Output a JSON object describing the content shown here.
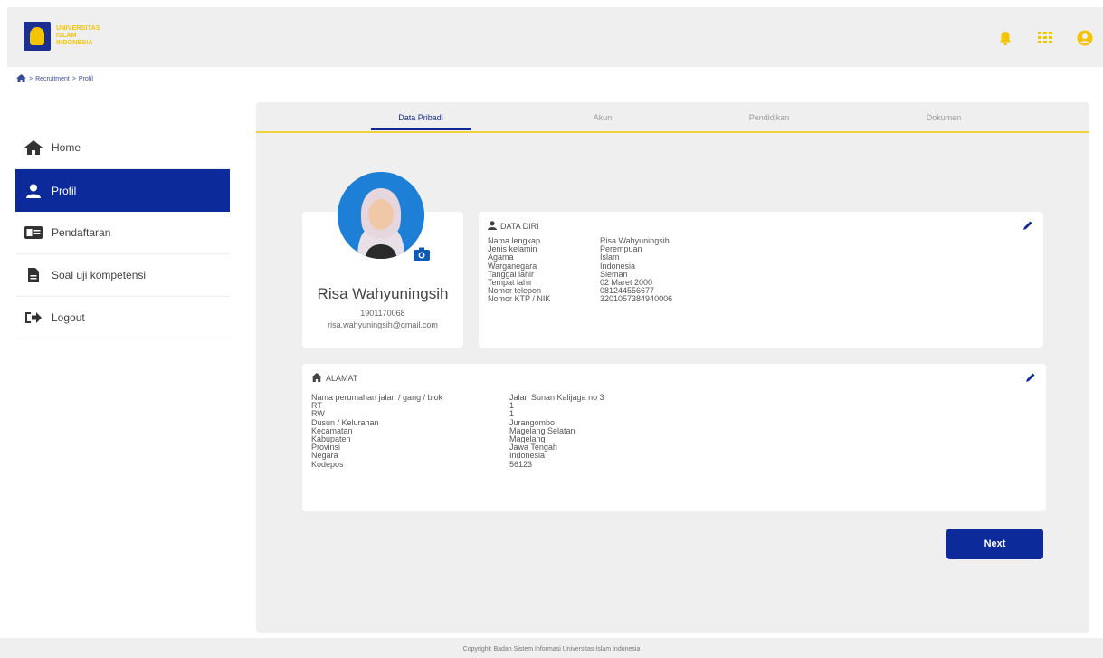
{
  "header": {
    "logo_line1": "UNIVERSITAS",
    "logo_line2": "ISLAM",
    "logo_line3": "INDONESIA",
    "icons": [
      "bell-icon",
      "apps-grid-icon",
      "user-circle-icon"
    ],
    "accent_color": "#f4c400"
  },
  "breadcrumb": {
    "items": [
      "Recruitment",
      "Profil"
    ],
    "separator": ">"
  },
  "sidebar": {
    "items": [
      {
        "label": "Home",
        "icon": "home-icon"
      },
      {
        "label": "Profil",
        "icon": "user-icon",
        "active": true
      },
      {
        "label": "Pendaftaran",
        "icon": "id-card-icon"
      },
      {
        "label": "Soal uji kompetensi",
        "icon": "file-icon"
      },
      {
        "label": "Logout",
        "icon": "logout-icon"
      }
    ]
  },
  "tabs": [
    {
      "label": "Data Pribadi",
      "active": true
    },
    {
      "label": "Akun"
    },
    {
      "label": "Pendidikan"
    },
    {
      "label": "Dokumen"
    }
  ],
  "profile": {
    "name": "Risa Wahyuningsih",
    "id": "1901170068",
    "email": "risa.wahyuningsih@gmail.com"
  },
  "data_diri": {
    "title": "DATA DIRI",
    "rows": [
      {
        "key": "Nama lengkap",
        "value": "Risa Wahyuningsih"
      },
      {
        "key": "Jenis kelamin",
        "value": "Perempuan"
      },
      {
        "key": "Agama",
        "value": "Islam"
      },
      {
        "key": "Warganegara",
        "value": "Indonesia"
      },
      {
        "key": "Tanggal lahir",
        "value": "Sleman"
      },
      {
        "key": "Tempat lahir",
        "value": "02 Maret 2000"
      },
      {
        "key": "Nomor telepon",
        "value": "081244556677"
      },
      {
        "key": "Nomor KTP / NIK",
        "value": "3201057384940006"
      }
    ]
  },
  "alamat": {
    "title": "ALAMAT",
    "rows": [
      {
        "key": "Nama perumahan jalan / gang /  blok",
        "value": "Jalan Sunan Kalijaga no 3"
      },
      {
        "key": "RT",
        "value": "1"
      },
      {
        "key": "RW",
        "value": "1"
      },
      {
        "key": "Dusun / Kelurahan",
        "value": "Jurangombo"
      },
      {
        "key": "Kecamatan",
        "value": "Magelang Selatan"
      },
      {
        "key": "Kabupaten",
        "value": "Magelang"
      },
      {
        "key": "Provinsi",
        "value": "Jawa Tengah"
      },
      {
        "key": "Negara",
        "value": "Indonesia"
      },
      {
        "key": "Kodepos",
        "value": "56123"
      }
    ]
  },
  "next_label": "Next",
  "footer": "Copyright: Badan Sistem Informasi Universitas Islam Indonesia",
  "colors": {
    "primary": "#0d2a9a",
    "tab_accent": "#f0d23c",
    "avatar_bg": "#1d7fd6"
  }
}
